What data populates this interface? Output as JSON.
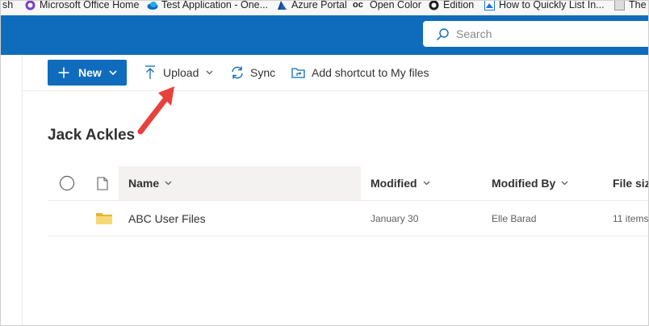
{
  "bookmarks": [
    {
      "label": "sh",
      "icon": "bookmark-icon"
    },
    {
      "label": "Microsoft Office Home",
      "icon": "office-icon"
    },
    {
      "label": "Test Application - One...",
      "icon": "onedrive-cloud-icon"
    },
    {
      "label": "Azure Portal",
      "icon": "azure-icon"
    },
    {
      "label": "Open Color",
      "icon": "open-color-icon"
    },
    {
      "label": "Edition",
      "icon": "edition-icon"
    },
    {
      "label": "How to Quickly List In...",
      "icon": "page-icon"
    },
    {
      "label": "The",
      "icon": "page-icon"
    }
  ],
  "header": {
    "search_placeholder": "Search",
    "brand_color": "#0f6cbd"
  },
  "command_bar": {
    "new_label": "New",
    "upload_label": "Upload",
    "sync_label": "Sync",
    "shortcut_label": "Add shortcut to My files"
  },
  "page": {
    "title": "Jack Ackles"
  },
  "list": {
    "columns": {
      "name": "Name",
      "modified": "Modified",
      "modified_by": "Modified By",
      "file_size": "File size"
    },
    "rows": [
      {
        "name": "ABC User Files",
        "modified": "January 30",
        "modified_by": "Elle Barad",
        "file_size": "11 items"
      }
    ]
  },
  "annotation": {
    "arrow_color": "#e8413c",
    "points_to": "Upload"
  }
}
